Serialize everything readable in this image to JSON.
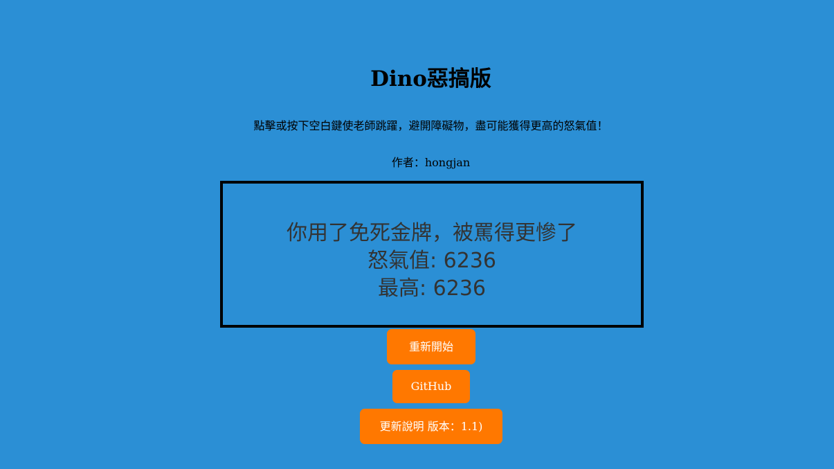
{
  "header": {
    "title": "Dino惡搞版",
    "subtitle": "點擊或按下空白鍵使老師跳躍，避開障礙物，盡可能獲得更高的怒氣值！",
    "author": "作者：hongjan"
  },
  "game": {
    "message": "你用了免死金牌，被罵得更慘了",
    "score_line": "怒氣值: 6236",
    "high_line": "最高: 6236",
    "score": 6236,
    "high_score": 6236
  },
  "buttons": {
    "restart_label": "重新開始",
    "github_label": "GitHub",
    "changelog_label": "更新說明 版本：1.1)"
  },
  "colors": {
    "background": "#2b8fd5",
    "button": "#ff7800",
    "button_text": "#ffffff",
    "game_text": "#333333",
    "border": "#000000"
  }
}
